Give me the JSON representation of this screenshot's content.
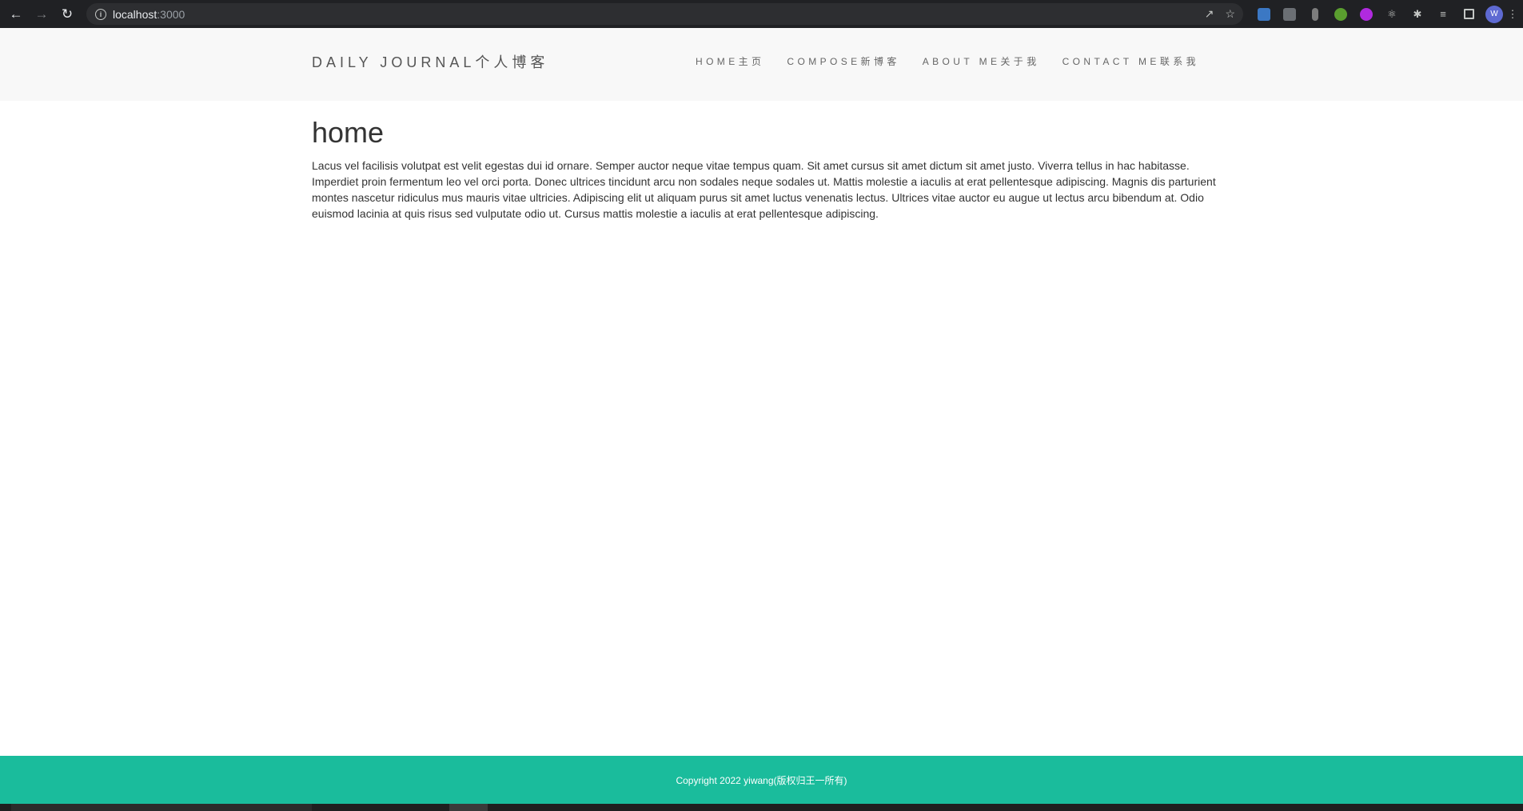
{
  "browser": {
    "url_host": "localhost",
    "url_port": ":3000",
    "profile_initial": "W",
    "extensions": [
      "s-extension-icon",
      "translate-icon",
      "mouse-icon",
      "tree-icon",
      "vpn-icon",
      "react-devtools-icon",
      "extensions-puzzle-icon",
      "reading-list-icon",
      "side-panel-icon"
    ]
  },
  "site": {
    "brand": "DAILY JOURNAL个人博客",
    "nav": [
      {
        "label": "HOME主页"
      },
      {
        "label": "COMPOSE新博客"
      },
      {
        "label": "ABOUT ME关于我"
      },
      {
        "label": "CONTACT ME联系我"
      }
    ],
    "page_title": "home",
    "page_body": "Lacus vel facilisis volutpat est velit egestas dui id ornare. Semper auctor neque vitae tempus quam. Sit amet cursus sit amet dictum sit amet justo. Viverra tellus in hac habitasse. Imperdiet proin fermentum leo vel orci porta. Donec ultrices tincidunt arcu non sodales neque sodales ut. Mattis molestie a iaculis at erat pellentesque adipiscing. Magnis dis parturient montes nascetur ridiculus mus mauris vitae ultricies. Adipiscing elit ut aliquam purus sit amet luctus venenatis lectus. Ultrices vitae auctor eu augue ut lectus arcu bibendum at. Odio euismod lacinia at quis risus sed vulputate odio ut. Cursus mattis molestie a iaculis at erat pellentesque adipiscing.",
    "footer": "Copyright 2022 yiwang(版权归王一所有)"
  },
  "colors": {
    "chrome_bg": "#202124",
    "header_bg": "#f8f8f8",
    "footer_bg": "#1abc9c"
  }
}
